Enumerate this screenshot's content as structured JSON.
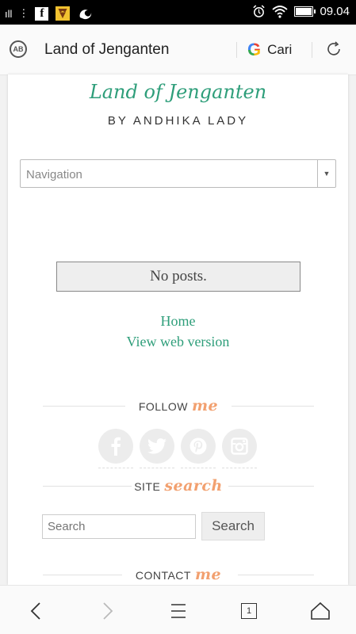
{
  "status_bar": {
    "time": "09.04",
    "signal_text": "ıll",
    "notification_app": "f"
  },
  "browser_bar": {
    "page_title": "Land of Jenganten",
    "search_logo": "G",
    "search_label": "Cari",
    "adblock_label": "AB"
  },
  "blog": {
    "title": "Land of Jenganten",
    "subtitle": "BY ANDHIKA LADY",
    "navigation_placeholder": "Navigation",
    "no_posts": "No posts.",
    "home_link": "Home",
    "web_version_link": "View web version"
  },
  "widgets": {
    "follow": {
      "label": "FOLLOW",
      "accent": "me"
    },
    "site_search": {
      "label": "SITE",
      "accent": "search"
    },
    "contact": {
      "label": "CONTACT",
      "accent": "me"
    }
  },
  "social_icons": [
    "facebook-icon",
    "twitter-icon",
    "pinterest-icon",
    "instagram-icon"
  ],
  "search": {
    "placeholder": "Search",
    "button_label": "Search"
  },
  "tab_count": "1",
  "colors": {
    "accent_green": "#2e9e7a",
    "accent_orange": "#f2a06f"
  }
}
